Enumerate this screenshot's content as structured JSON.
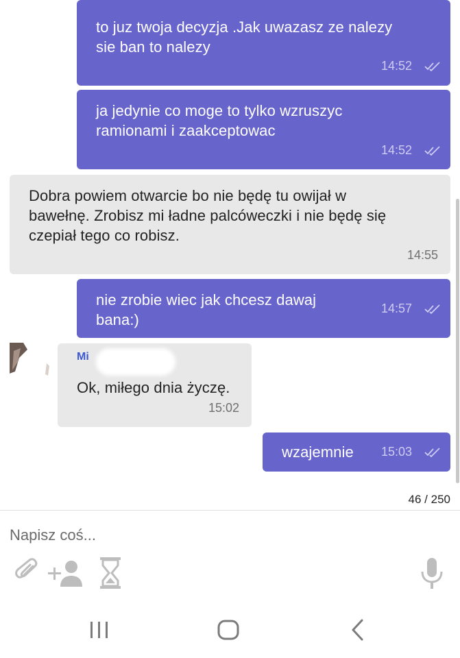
{
  "messages": [
    {
      "text_line1": "to juz twoja decyzja .Jak uwazasz ze nalezy",
      "text_line2": "sie ban to nalezy",
      "time": "14:52"
    },
    {
      "text_line1": "ja jedynie co moge to tylko wzruszyc",
      "text_line2": "ramionami i zaakceptowac",
      "time": "14:52"
    },
    {
      "text_line1": "Dobra powiem otwarcie bo nie będę tu owijał w",
      "text_line2": "bawełnę. Zrobisz mi ładne palcóweczki i nie będę się",
      "text_line3": "czepiał tego co robisz.",
      "time": "14:55"
    },
    {
      "text_line1": "nie zrobie wiec jak chcesz dawaj",
      "text_line2": "bana:)",
      "time": "14:57"
    },
    {
      "sender": "Mi",
      "text": "Ok, miłego dnia życzę.",
      "time": "15:02"
    },
    {
      "text": "wzajemnie",
      "time": "15:03"
    }
  ],
  "counter": "46 / 250",
  "composer": {
    "placeholder": "Napisz coś..."
  },
  "toolbar_icons": [
    "paperclip-icon",
    "add-person-icon",
    "hourglass-icon",
    "microphone-icon"
  ],
  "nav_icons": [
    "recent-apps-icon",
    "home-icon",
    "back-icon"
  ],
  "colors": {
    "outgoing": "#6764cc",
    "incoming": "#e8e8e8",
    "sender_name": "#3b57d3"
  }
}
